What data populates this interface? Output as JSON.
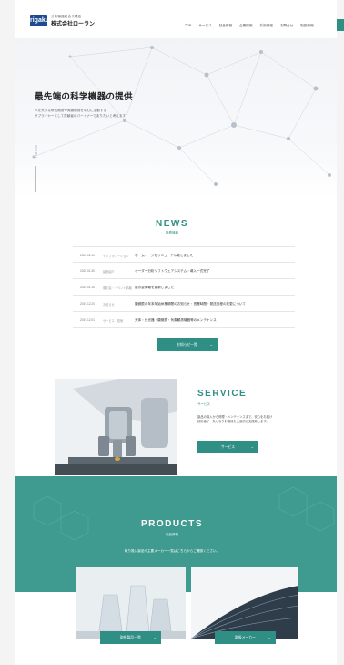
{
  "header": {
    "logo_text": "rigaku",
    "company_sub": "分析機器総合代理店",
    "company_name": "株式会社ローラン",
    "nav": [
      "TOP",
      "サービス",
      "製品情報",
      "企業情報",
      "採用情報",
      "お問合せ",
      "取扱情報"
    ]
  },
  "hero": {
    "title": "最先端の科学機器の提供",
    "subtitle_line1": "人を大きな研究開発や実験開発を中心に活動する",
    "subtitle_line2": "サプライヤーとして貢献者のパートナーでありたいと考えます。",
    "scroll_label": "SCROLL"
  },
  "news": {
    "title": "NEWS",
    "subtitle": "新着情報",
    "items": [
      {
        "date": "2020.02.10",
        "category": "インフォメーション",
        "text": "ホームページをリニューアル致しました"
      },
      {
        "date": "2020.01.30",
        "category": "製品紹介",
        "text": "オーダー分析ソフトウェアシステム・導入一式完了"
      },
      {
        "date": "2020.01.15",
        "category": "展示会・イベント情報",
        "text": "展示会情報を更新しました"
      },
      {
        "date": "2019.12.20",
        "category": "お知らせ",
        "text": "顕微鏡の年末年始休業期間のお知らせ・営業時間・発送日程の変更について"
      },
      {
        "date": "2019.12.01",
        "category": "サービス・技術",
        "text": "天体・分光器・顕微鏡・気象観測機器等のメンテナンス"
      }
    ],
    "button_label": "お知らせ一覧"
  },
  "service": {
    "title": "SERVICE",
    "subtitle": "サービス",
    "desc_line1": "製品の購入から修理・メンテナンスまで、安心をお届け",
    "desc_line2": "技術者が一丸となりお客様を全面的に支援致します。",
    "button_label": "サービス"
  },
  "products": {
    "title": "PRODUCTS",
    "subtitle": "製品情報",
    "desc": "取り扱い製品や主要メーカー一覧はこちらからご確認ください。",
    "button1_label": "取扱製品一覧",
    "button2_label": "取扱メーカー"
  },
  "colors": {
    "accent": "#2f8f84",
    "products_bg": "#3f9a8f",
    "logo_bg": "#1d4b8f"
  }
}
